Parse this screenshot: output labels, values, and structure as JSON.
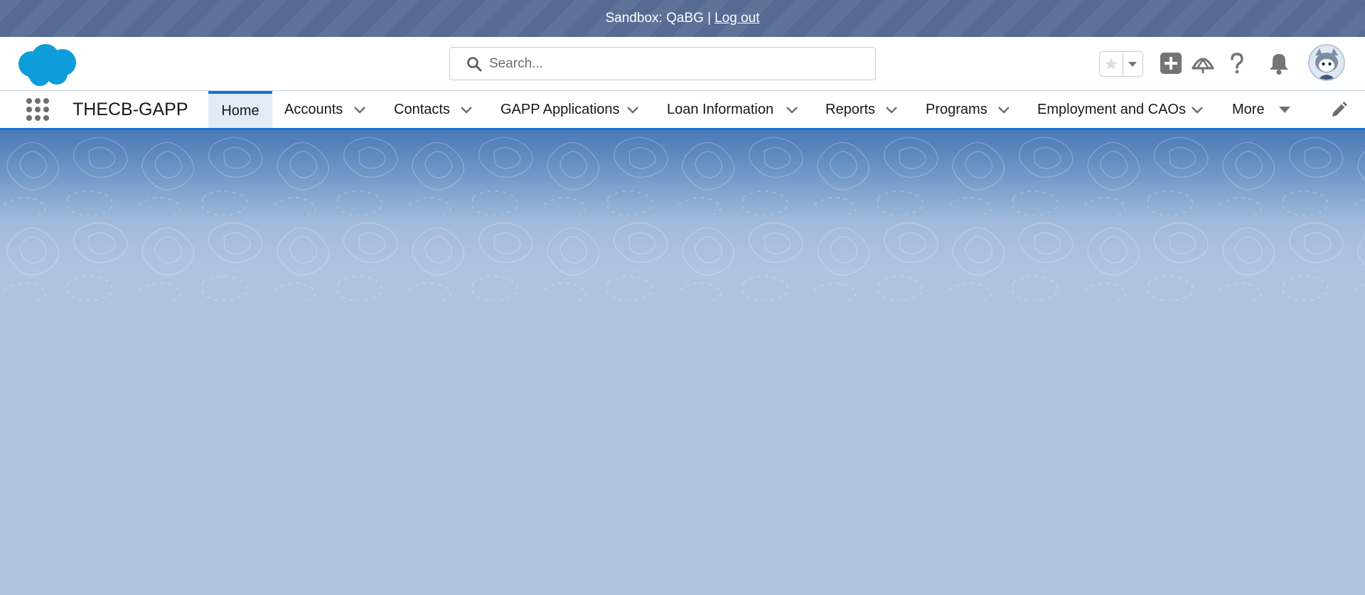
{
  "sandbox": {
    "text": "Sandbox: QaBG |",
    "logout_label": "Log out"
  },
  "header": {
    "logo_icon": "salesforce-cloud-logo",
    "search_placeholder": "Search...",
    "icons": [
      "star-icon",
      "caret-down-icon",
      "add-icon",
      "trailhead-icon",
      "help-icon",
      "bell-icon",
      "avatar"
    ]
  },
  "nav": {
    "app_name": "THECB-GAPP",
    "tabs": [
      {
        "label": "Home",
        "active": true
      },
      {
        "label": "Accounts"
      },
      {
        "label": "Contacts"
      },
      {
        "label": "GAPP Applications"
      },
      {
        "label": "Loan Information"
      },
      {
        "label": "Reports"
      },
      {
        "label": "Programs"
      },
      {
        "label": "Employment and CAOs"
      },
      {
        "label": "More"
      }
    ]
  },
  "colors": {
    "banner": "#566a92",
    "brand_blue": "#1b73d3",
    "logo_blue": "#0d9dda",
    "background": "#b0c4df"
  }
}
